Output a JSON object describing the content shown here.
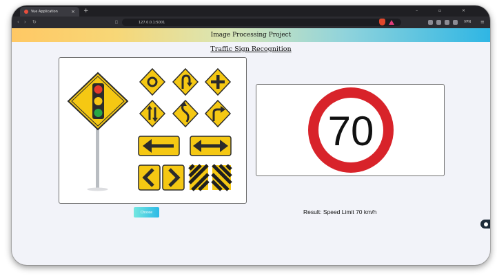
{
  "browser": {
    "tab_title": "Vue Application",
    "tab_close": "×",
    "new_tab": "+",
    "window_controls": "– ▫ ×",
    "back": "‹",
    "forward": "›",
    "reload": "↻",
    "url": "127.0.0.1:5001",
    "vpn_label": "VPN",
    "menu": "≡"
  },
  "app": {
    "header_title": "Image Processing Project",
    "subtitle": "Traffic Sign Recognition",
    "choose_label": "Choose",
    "result_text": "Result: Speed Limit 70 km/h",
    "speed_sign_value": "70"
  },
  "colors": {
    "sign_yellow": "#f5c813",
    "sign_red": "#d8232a",
    "header_gradient": [
      "#ffc864",
      "#2fb6e4"
    ],
    "button_gradient": [
      "#74e7e0",
      "#2cb9e6"
    ]
  }
}
